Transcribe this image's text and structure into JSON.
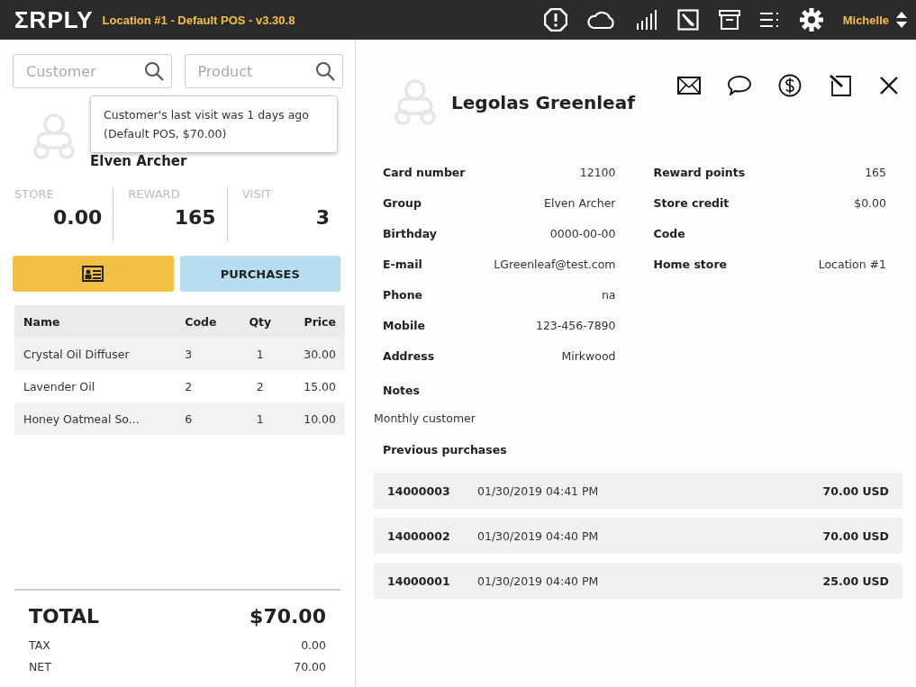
{
  "topbar": {
    "logo": "ΣRPLY",
    "location": "Location #1 - Default POS - v3.30.8",
    "user": "Michelle"
  },
  "search": [
    {
      "placeholder": "Customer"
    },
    {
      "placeholder": "Product"
    }
  ],
  "customer_card": {
    "group": "Elven Archer",
    "tooltip": "Customer's last visit was 1 days ago (Default POS, $70.00)"
  },
  "stats": [
    {
      "label": "STORE",
      "value": "0.00"
    },
    {
      "label": "REWARD",
      "value": "165"
    },
    {
      "label": "VISIT",
      "value": "3"
    }
  ],
  "buttons": [
    {
      "kind": "icon"
    },
    {
      "kind": "text",
      "label": "PURCHASES"
    }
  ],
  "cart": {
    "columns": [
      "Name",
      "Code",
      "Qty",
      "Price"
    ],
    "rows": [
      [
        "Crystal Oil Diffuser",
        "3",
        "1",
        "30.00"
      ],
      [
        "Lavender Oil",
        "2",
        "2",
        "15.00"
      ],
      [
        "Honey Oatmeal So...",
        "6",
        "1",
        "10.00"
      ]
    ]
  },
  "totals": {
    "total_label": "TOTAL",
    "total": "$70.00",
    "lines": [
      {
        "label": "TAX",
        "value": "0.00"
      },
      {
        "label": "NET",
        "value": "70.00"
      }
    ]
  },
  "customer": {
    "name": "Legolas Greenleaf",
    "left_fields": [
      {
        "label": "Card number",
        "value": "12100"
      },
      {
        "label": "Group",
        "value": "Elven Archer"
      },
      {
        "label": "Birthday",
        "value": "0000-00-00"
      },
      {
        "label": "E-mail",
        "value": "LGreenleaf@test.com"
      },
      {
        "label": "Phone",
        "value": "na"
      },
      {
        "label": "Mobile",
        "value": "123-456-7890"
      },
      {
        "label": "Address",
        "value": "Mirkwood"
      }
    ],
    "right_fields": [
      {
        "label": "Reward points",
        "value": "165"
      },
      {
        "label": "Store credit",
        "value": "$0.00"
      },
      {
        "label": "Code"
      },
      {
        "label": "Home store",
        "value": "Location #1"
      }
    ],
    "notes_label": "Notes",
    "notes": "Monthly customer",
    "purchases_label": "Previous purchases",
    "purchases": [
      {
        "number": "14000003",
        "date": "01/30/2019 04:41 PM",
        "amount": "70.00 USD"
      },
      {
        "number": "14000002",
        "date": "01/30/2019 04:40 PM",
        "amount": "70.00 USD"
      },
      {
        "number": "14000001",
        "date": "01/30/2019 04:40 PM",
        "amount": "25.00 USD"
      }
    ]
  }
}
